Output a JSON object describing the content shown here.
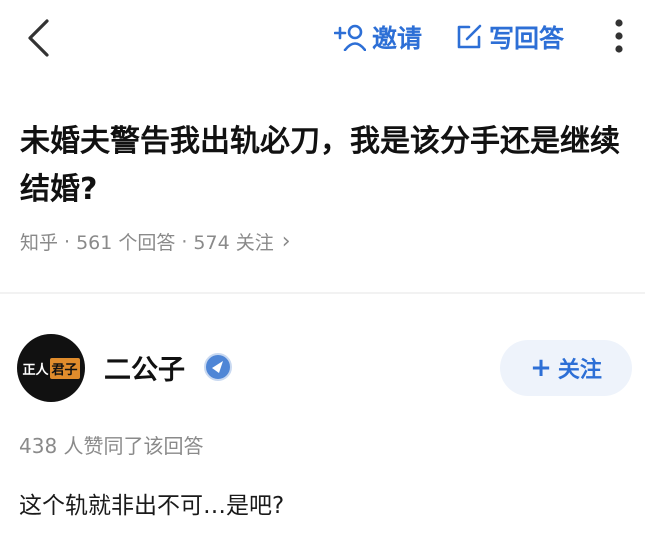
{
  "header": {
    "invite_label": "邀请",
    "write_answer_label": "写回答",
    "icons": {
      "back": "chevron-left-icon",
      "invite": "add-user-icon",
      "write": "edit-icon",
      "more": "more-vertical-icon"
    },
    "accent_color": "#2d6fd6"
  },
  "question": {
    "title": "未婚夫警告我出轨必刀，我是该分手还是继续结婚?",
    "source": "知乎",
    "answers_count": "561 个回答",
    "followers_count": "574 关注",
    "separator": "·",
    "chevron": "›"
  },
  "answer": {
    "author": {
      "avatar_text": "正人",
      "avatar_tag": "君子",
      "name": "二公子"
    },
    "follow_label": "关注",
    "follow_plus": "+",
    "likes_text": "438 人赞同了该回答",
    "content": "这个轨就非出不可…是吧?"
  }
}
